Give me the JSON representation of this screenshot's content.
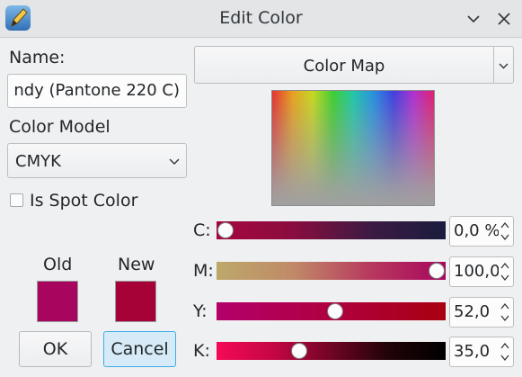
{
  "window": {
    "title": "Edit Color",
    "icons": {
      "app": "pencil-app-icon",
      "minimize": "chevron-down-icon",
      "close": "close-icon"
    }
  },
  "form": {
    "name_label": "Name:",
    "name_value": "ndy (Pantone 220 C)",
    "color_model_label": "Color Model",
    "color_model_value": "CMYK",
    "spot_color_label": "Is Spot Color",
    "spot_color_checked": false
  },
  "preview": {
    "old_label": "Old",
    "new_label": "New",
    "old_color": "#a8065e",
    "new_color": "#a60238"
  },
  "buttons": {
    "ok": "OK",
    "cancel": "Cancel"
  },
  "color_map": {
    "selector_value": "Color Map"
  },
  "sliders": [
    {
      "label": "C:",
      "value_text": "0,0 %",
      "level": 0.0
    },
    {
      "label": "M:",
      "value_text": "100,0",
      "level": 1.0
    },
    {
      "label": "Y:",
      "value_text": "52,0",
      "level": 0.52
    },
    {
      "label": "K:",
      "value_text": "35,0",
      "level": 0.35
    }
  ]
}
